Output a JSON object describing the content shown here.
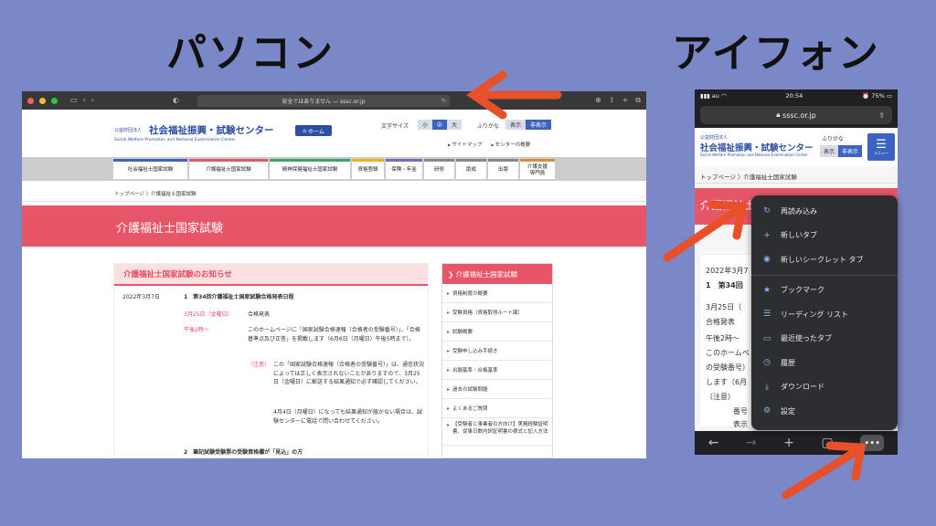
{
  "labels": {
    "pc": "パソコン",
    "phone": "アイフォン"
  },
  "desktop": {
    "url": "安全ではありません — sssc.or.jp",
    "org_small": "公益財団法人",
    "org_name": "社会福祉振興・試験センター",
    "org_en": "Social Welfare Promotion and National Examination Center",
    "home": "ホーム",
    "font_size_label": "文字サイズ",
    "font_sizes": [
      "小",
      "中",
      "大"
    ],
    "furigana": "ふりがな",
    "furi_opts": [
      "表示",
      "非表示"
    ],
    "links": [
      "サイトマップ",
      "センターの概要"
    ],
    "nav": [
      "社会福祉士国家試験",
      "介護福祉士国家試験",
      "精神保健福祉士国家試験",
      "資格登録",
      "保険・年金",
      "研修",
      "助成",
      "出版",
      "介護支援\n専門員"
    ],
    "breadcrumb": "トップページ 〉介護福祉士国家試験",
    "banner": "介護福祉士国家試験",
    "news_title": "介護福祉士国家試験のお知らせ",
    "news": {
      "date": "2022年3月7日",
      "item1": "1　第34回介護福祉士国家試験合格発表日程",
      "d1": "3月25日（金曜日）",
      "d1_text": "合格発表",
      "t1": "午後2時〜",
      "p1": "このホームページに「国家試験合格速報（合格者の受験番号）」、「合格基準点及び正答」を掲載します（6月6日（月曜日）午後5時まで）。",
      "note": "（注意）",
      "p2": "この「国家試験合格速報（合格者の受験番号）」は、通信状況によっては正しく表示されないことがありますので、3月25日（金曜日）に郵送する結果通知で必ず確認してください。",
      "p3": "4月4日（月曜日）になっても結果通知が届かない場合は、試験センターに電話で問い合わせてください。",
      "item2": "2　筆記試験受験票の受験資格欄が「見込」の方"
    },
    "side_title": "介護福祉士国家試験",
    "side_items": [
      "資格制度の概要",
      "受験資格（資格取得ルート図）",
      "試験概要",
      "受験申し込み手続き",
      "出題基準・合格基準",
      "過去の試験問題",
      "よくあるご質問",
      "【受験者と事業者の方向け】実務経験証明書、従事日数内訳証明書の様式と記入方法"
    ]
  },
  "phone": {
    "carrier": "au",
    "time": "20:54",
    "battery": "75%",
    "url": "sssc.or.jp",
    "org_small": "公益財団法人",
    "org_name": "社会福祉振興・試験センター",
    "org_en": "Social Welfare Promotion and National Examination Center",
    "furigana": "ふりがな",
    "furi_opts": [
      "表示",
      "非表示"
    ],
    "menu": "メニュー",
    "breadcrumb": "トップページ 〉介護福祉士国家試験",
    "banner": "介護福祉士国家試験",
    "date": "2022年3月7",
    "item1": "1　第34回",
    "d1": "3月25日（",
    "d1_text": "合格発表",
    "t1": "午後2時〜",
    "p1a": "このホームペ",
    "p1b": "の受験番号）",
    "p1c": "します（6月",
    "note": "（注意）",
    "p2a": "番号",
    "p2b": "表示",
    "context_menu": [
      "再読み込み",
      "新しいタブ",
      "新しいシークレット タブ",
      "ブックマーク",
      "リーディング リスト",
      "最近使ったタブ",
      "履歴",
      "ダウンロード",
      "設定"
    ],
    "context_icons": [
      "reload-icon",
      "plus-icon",
      "incognito-icon",
      "star-icon",
      "list-icon",
      "recent-tabs-icon",
      "history-icon",
      "download-icon",
      "gear-icon"
    ]
  },
  "colors": {
    "background": "#7b88c7",
    "arrow": "#e8502a",
    "brand_blue": "#2b4fa3",
    "banner_red": "#e75569"
  }
}
